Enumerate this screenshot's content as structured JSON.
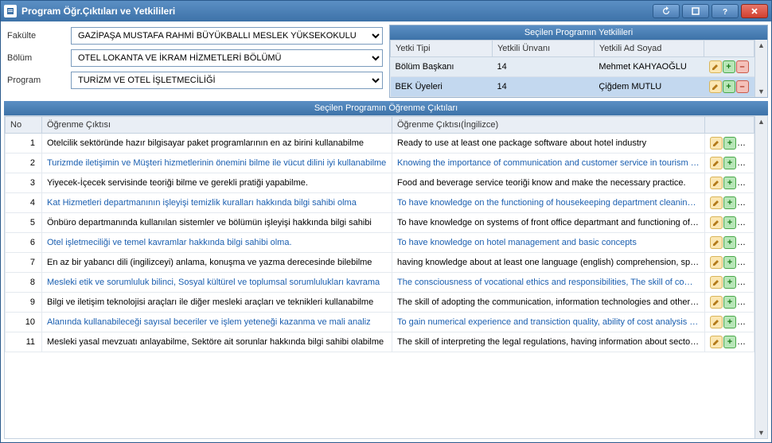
{
  "window": {
    "title": "Program Öğr.Çıktıları ve Yetkilileri"
  },
  "filters": {
    "fakulte_label": "Fakülte",
    "fakulte_value": "GAZİPAŞA MUSTAFA RAHMİ BÜYÜKBALLI MESLEK YÜKSEKOKULU",
    "bolum_label": "Bölüm",
    "bolum_value": "OTEL LOKANTA VE İKRAM HİZMETLERİ BÖLÜMÜ",
    "program_label": "Program",
    "program_value": "TURİZM VE OTEL İŞLETMECİLİĞİ"
  },
  "auth": {
    "panel_title": "Seçilen Programın Yetkilileri",
    "cols": {
      "tipi": "Yetki Tipi",
      "unvan": "Yetkili Ünvanı",
      "adsoyad": "Yetkili Ad Soyad"
    },
    "rows": [
      {
        "tipi": "Bölüm Başkanı",
        "unvan": "14",
        "adsoyad": "Mehmet KAHYAOĞLU"
      },
      {
        "tipi": "BEK Üyeleri",
        "unvan": "14",
        "adsoyad": "Çiğdem MUTLU"
      }
    ]
  },
  "outcomes": {
    "panel_title": "Seçilen Programın Öğrenme Çıktıları",
    "cols": {
      "no": "No",
      "c1": "Öğrenme Çıktısı",
      "c2": "Öğrenme Çıktısı(İngilizce)"
    },
    "rows": [
      {
        "no": "1",
        "c1": "Otelcilik sektöründe hazır bilgisayar paket programlarının en az birini kullanabilme",
        "c2": "Ready to use at least one package software about hotel industry",
        "link": false
      },
      {
        "no": "2",
        "c1": "Turizmde iletişimin ve Müşteri hizmetlerinin önemini bilme ile vücut dilini iyi kullanabilme",
        "c2": "Knowing the importance of communication and customer service in tourism and to",
        "link": true
      },
      {
        "no": "3",
        "c1": "Yiyecek-İçecek servisinde teoriği bilme ve gerekli pratiği yapabilme.",
        "c2": "Food and beverage service teoriği know and make the necessary practice.",
        "link": false
      },
      {
        "no": "4",
        "c1": "Kat Hizmetleri departmanının işleyişi temizlik kuralları hakkında bilgi sahibi olma",
        "c2": "To have knowledge on the functioning of housekeeping department cleaning rules",
        "link": true
      },
      {
        "no": "5",
        "c1": "Önbüro departmanında kullanılan sistemler ve bölümün işleyişi hakkında bilgi sahibi",
        "c2": "To have knowledge on systems of front office departmant and functioning ofdepar",
        "link": false
      },
      {
        "no": "6",
        "c1": "Otel işletmeciliği ve temel kavramlar hakkında bilgi sahibi olma.",
        "c2": "To have knowledge on hotel management and basic concepts",
        "link": true
      },
      {
        "no": "7",
        "c1": "En az bir yabancı dili (ingilizceyi) anlama, konuşma ve yazma derecesinde bilebilme",
        "c2": "having knowledge about at least one language (english) comprehension, speaking",
        "link": false
      },
      {
        "no": "8",
        "c1": "Mesleki etik ve sorumluluk bilinci, Sosyal kültürel ve toplumsal sorumlulukları kavrama",
        "c2": "The consciousness of vocational ethics and responsibilities, The skill of comprehen",
        "link": true
      },
      {
        "no": "9",
        "c1": "Bilgi ve iletişim teknolojisi araçları ile diğer mesleki araçları ve teknikleri kullanabilme",
        "c2": "The skill of adopting the communication, information technologies and other techn",
        "link": false
      },
      {
        "no": "10",
        "c1": "Alanında kullanabileceği sayısal beceriler ve işlem yeteneği kazanma ve mali analiz",
        "c2": "To gain numerical experience and transiction quality, ability of cost analysis at own",
        "link": true
      },
      {
        "no": "11",
        "c1": "Mesleki yasal mevzuatı anlayabilme, Sektöre ait sorunlar hakkında bilgi sahibi olabilme",
        "c2": "The skill of interpreting the legal regulations, having information about sector prob",
        "link": false
      }
    ]
  }
}
